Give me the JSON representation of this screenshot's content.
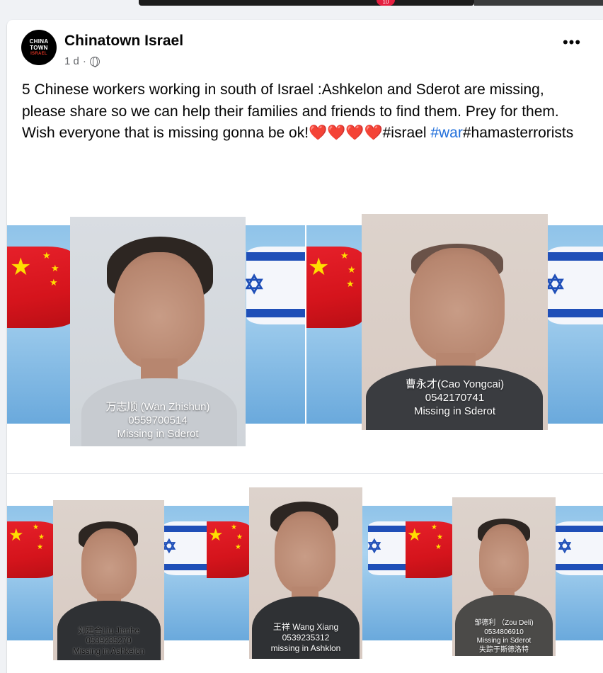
{
  "post": {
    "page_name": "Chinatown Israel",
    "avatar_lines": [
      "CHINA",
      "TOWN",
      "ISRAEL"
    ],
    "time": "1 d",
    "separator": "·",
    "more_label": "•••",
    "text_main": "5 Chinese workers working in south of Israel :Ashkelon and Sderot are missing, please share so we can help their families and friends to find them. Prey for them. Wish everyone that is missing gonna be ok!❤️❤️❤️❤️#israel ",
    "hashtag_war": "#war",
    "hashtag_rest": "#hamasterrorists"
  },
  "notification_count": "10",
  "photos": [
    {
      "name_line": "万志顺 (Wan Zhishun)",
      "phone": "0559700514",
      "status": "Missing in Sderot"
    },
    {
      "name_line": "曹永才(Cao Yongcai)",
      "phone": "0542170741",
      "status": "Missing in Sderot"
    },
    {
      "name_line": "刘建合Liu Jianhe",
      "phone": "0539235270",
      "status": "Missing in Ashkelon"
    },
    {
      "name_line": "王祥 Wang Xiang",
      "phone": "0539235312",
      "status": "missing in Ashklon"
    },
    {
      "name_line": "邹德利 （Zou Deli)",
      "phone": "0534806910",
      "status": "Missing in Sderot",
      "extra": "失踪于斯德洛特"
    }
  ],
  "colors": {
    "hashtag": "#216fdb",
    "text": "#050505",
    "muted": "#65676b",
    "cn_red": "#de2910",
    "il_blue": "#1f4fb8"
  }
}
